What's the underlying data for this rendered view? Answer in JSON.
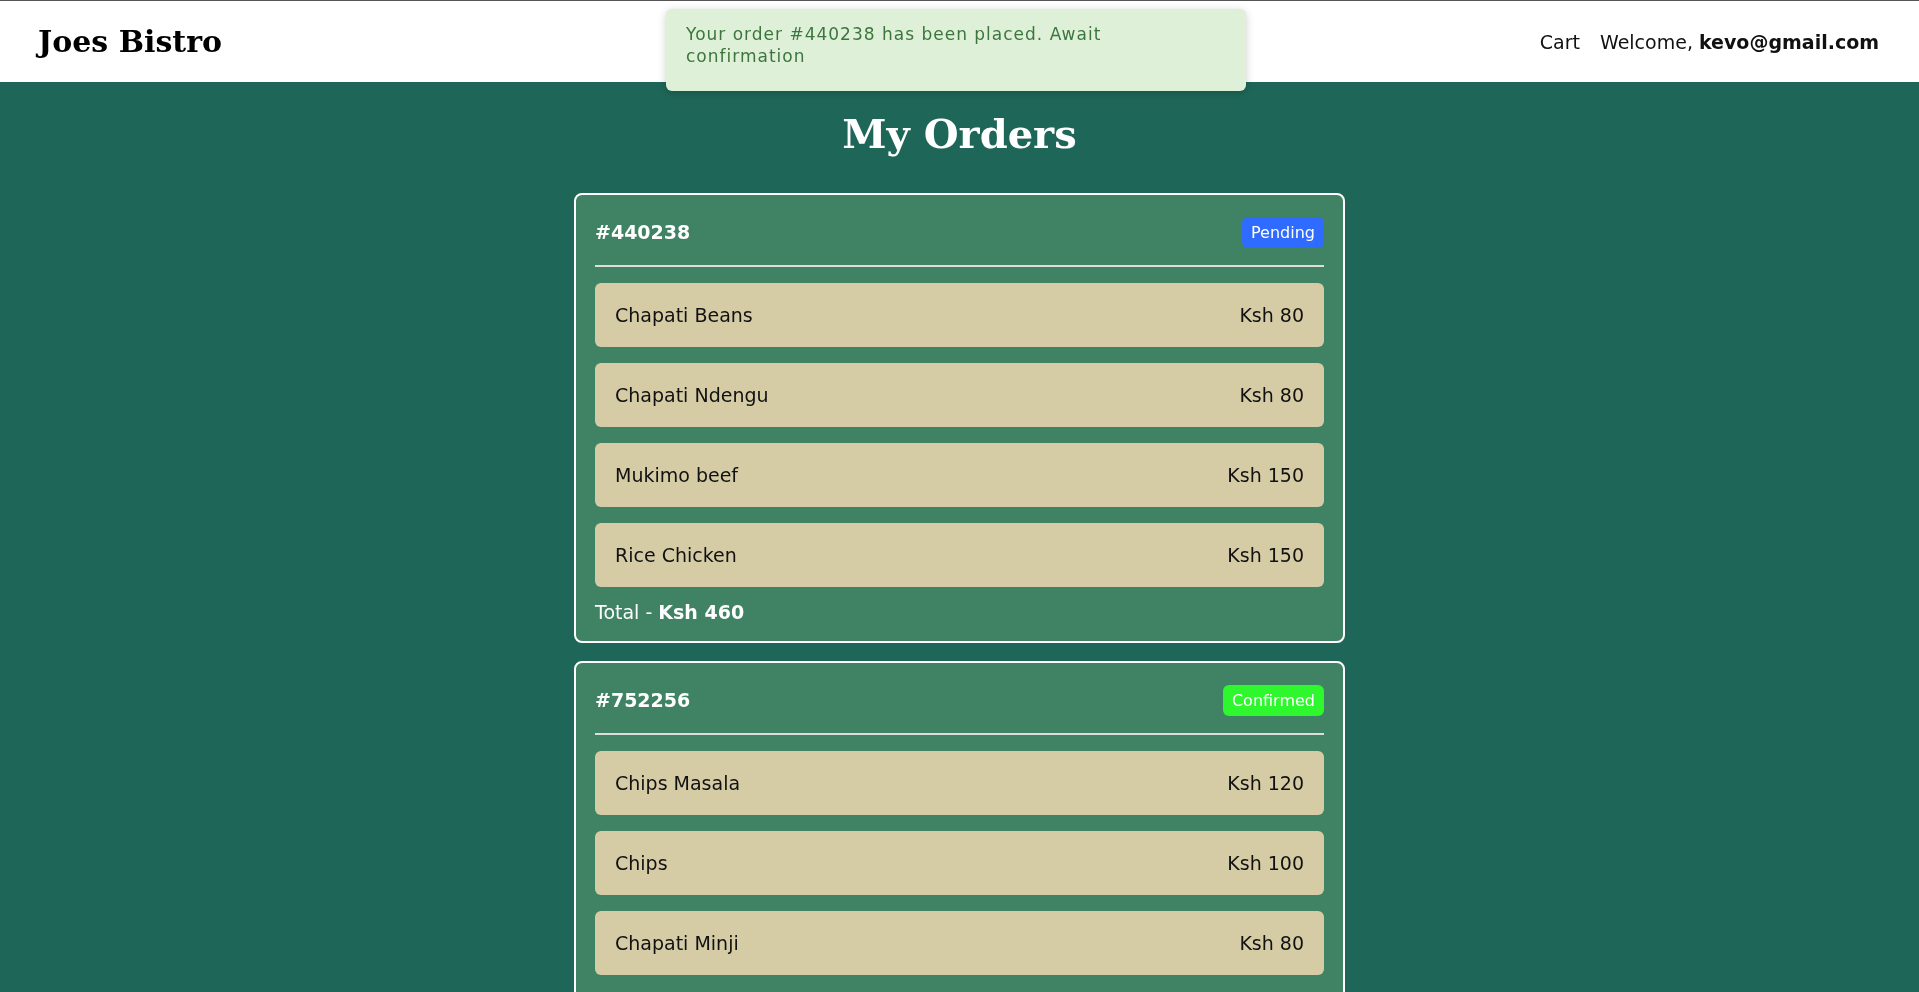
{
  "header": {
    "logo": "Joes Bistro",
    "cart_link": "Cart",
    "welcome": "Welcome, **kevo@gmail.com**"
  },
  "toast": {
    "message": "Your order #440238 has been placed. Await confirmation"
  },
  "page_title": "My Orders",
  "orders": [
    {
      "id": "#440238",
      "status": {
        "label": "Pending",
        "kind": "pending"
      },
      "items": [
        {
          "name": "Chapati Beans",
          "price": "Ksh 80"
        },
        {
          "name": "Chapati Ndengu",
          "price": "Ksh 80"
        },
        {
          "name": "Mukimo beef",
          "price": "Ksh 150"
        },
        {
          "name": "Rice Chicken",
          "price": "Ksh 150"
        }
      ],
      "total": "Total - **Ksh 460**"
    },
    {
      "id": "#752256",
      "status": {
        "label": "Confirmed",
        "kind": "confirmed"
      },
      "items": [
        {
          "name": "Chips Masala",
          "price": "Ksh 120"
        },
        {
          "name": "Chips",
          "price": "Ksh 100"
        },
        {
          "name": "Chapati Minji",
          "price": "Ksh 80"
        }
      ]
    }
  ]
}
